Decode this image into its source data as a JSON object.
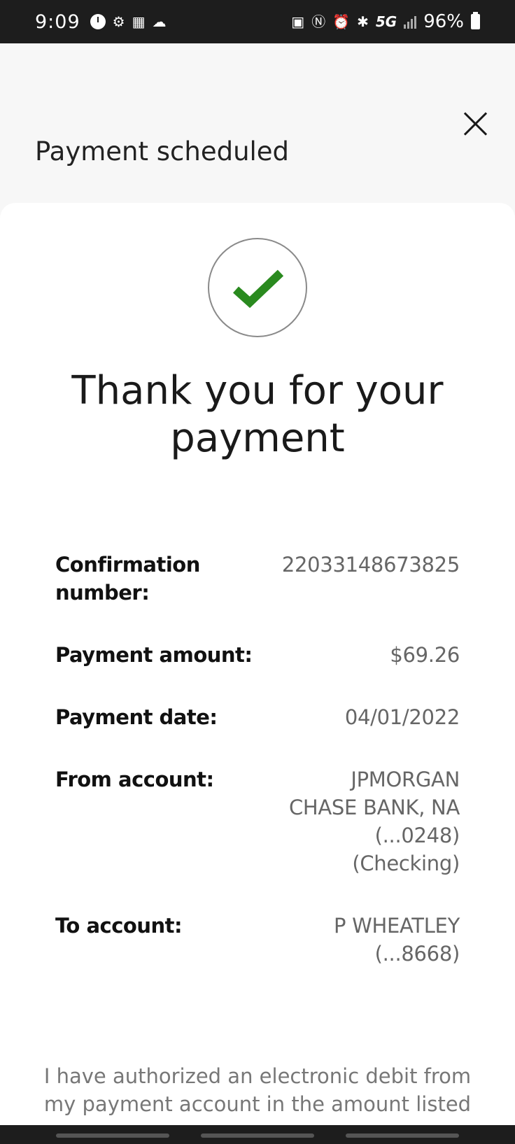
{
  "status_bar": {
    "time": "9:09",
    "network": "5G",
    "battery": "96%"
  },
  "header": {
    "title": "Payment scheduled"
  },
  "confirmation": {
    "heading": "Thank you for your payment",
    "rows": [
      {
        "label": "Confirmation number:",
        "value": "22033148673825"
      },
      {
        "label": "Payment amount:",
        "value": "$69.26"
      },
      {
        "label": "Payment date:",
        "value": "04/01/2022"
      },
      {
        "label": "From account:",
        "value": "JPMORGAN CHASE BANK, NA (...0248) (Checking)"
      },
      {
        "label": "To account:",
        "value": "P WHEATLEY (...8668)"
      }
    ],
    "authorization": "I have authorized an electronic debit from my payment account in the amount listed"
  },
  "colors": {
    "check": "#2a8a1f",
    "status_bar_bg": "#1d1d1d",
    "page_bg": "#f7f7f7"
  }
}
